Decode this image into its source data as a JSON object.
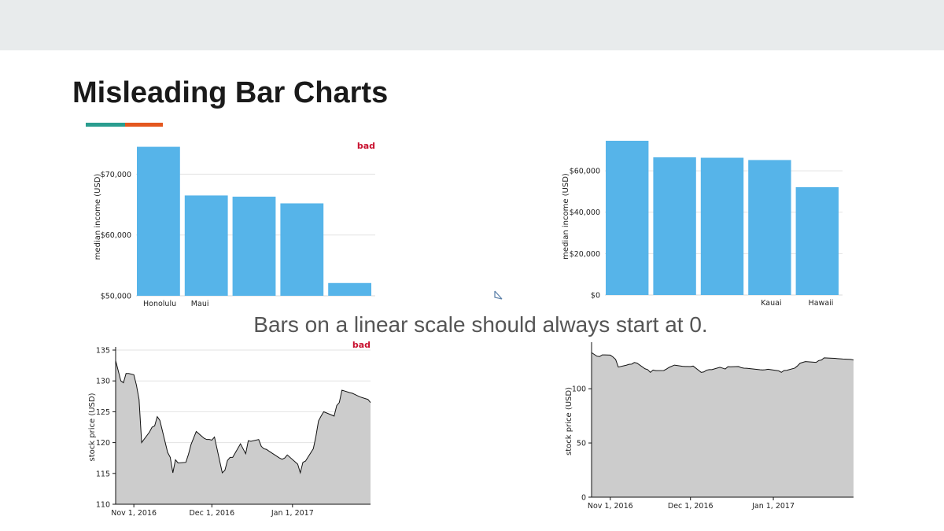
{
  "title": "Misleading Bar Charts",
  "caption": "Bars on a linear scale should always start at 0.",
  "colors": {
    "bar": "#56b4e9",
    "area": "#cccccc",
    "bad": "#c8102e",
    "accent_teal": "#2a9d8f",
    "accent_orange": "#e4571e",
    "topbar": "#e8ebec"
  },
  "chart_data": [
    {
      "type": "bar",
      "badge": "bad",
      "ylabel": "median income (USD)",
      "categories": [
        "Honolulu",
        "Maui",
        "",
        "",
        ""
      ],
      "values": [
        74500,
        66500,
        66300,
        65200,
        52100
      ],
      "ylim": [
        50000,
        76000
      ],
      "yticks": [
        50000,
        60000,
        70000
      ],
      "ytick_labels": [
        "$50,000",
        "$60,000",
        "$70,000"
      ]
    },
    {
      "type": "bar",
      "ylabel": "median income (USD)",
      "categories": [
        "",
        "",
        "",
        "Kauai",
        "Hawaii"
      ],
      "values": [
        74500,
        66500,
        66300,
        65200,
        52100
      ],
      "ylim": [
        0,
        76000
      ],
      "yticks": [
        0,
        20000,
        40000,
        60000
      ],
      "ytick_labels": [
        "$0",
        "$20,000",
        "$40,000",
        "$60,000"
      ]
    },
    {
      "type": "area",
      "badge": "bad",
      "ylabel": "stock price (USD)",
      "ylim": [
        110,
        135
      ],
      "yticks": [
        110,
        115,
        120,
        125,
        130,
        135
      ],
      "ytick_labels": [
        "110",
        "115",
        "120",
        "125",
        "130",
        "135"
      ],
      "xlim": [
        "2016-10-25",
        "2017-01-31"
      ],
      "xticks": [
        "2016-11-01",
        "2016-12-01",
        "2017-01-01"
      ],
      "xtick_labels": [
        "Nov 1, 2016",
        "Dec 1, 2016",
        "Jan 1, 2017"
      ],
      "x": [
        "2016-10-25",
        "2016-10-27",
        "2016-10-28",
        "2016-10-29",
        "2016-10-30",
        "2016-11-01",
        "2016-11-02",
        "2016-11-03",
        "2016-11-04",
        "2016-11-07",
        "2016-11-08",
        "2016-11-09",
        "2016-11-10",
        "2016-11-11",
        "2016-11-14",
        "2016-11-15",
        "2016-11-16",
        "2016-11-17",
        "2016-11-18",
        "2016-11-21",
        "2016-11-22",
        "2016-11-23",
        "2016-11-25",
        "2016-11-28",
        "2016-11-29",
        "2016-11-30",
        "2016-12-01",
        "2016-12-02",
        "2016-12-05",
        "2016-12-06",
        "2016-12-07",
        "2016-12-08",
        "2016-12-09",
        "2016-12-12",
        "2016-12-13",
        "2016-12-14",
        "2016-12-15",
        "2016-12-16",
        "2016-12-19",
        "2016-12-20",
        "2016-12-21",
        "2016-12-22",
        "2016-12-23",
        "2016-12-27",
        "2016-12-28",
        "2016-12-29",
        "2016-12-30",
        "2017-01-03",
        "2017-01-04",
        "2017-01-05",
        "2017-01-06",
        "2017-01-09",
        "2017-01-10",
        "2017-01-11",
        "2017-01-12",
        "2017-01-13",
        "2017-01-17",
        "2017-01-18",
        "2017-01-19",
        "2017-01-20",
        "2017-01-23",
        "2017-01-24",
        "2017-01-25",
        "2017-01-26",
        "2017-01-27",
        "2017-01-30",
        "2017-01-31"
      ],
      "y": [
        133.3,
        130.0,
        129.7,
        131.2,
        131.2,
        131.0,
        129.3,
        127.0,
        120.0,
        121.7,
        122.5,
        122.7,
        124.2,
        123.6,
        118.4,
        117.6,
        115.1,
        117.2,
        116.7,
        116.8,
        118.1,
        119.7,
        121.8,
        120.7,
        120.5,
        120.5,
        120.4,
        120.9,
        115.1,
        115.5,
        117.1,
        117.6,
        117.6,
        119.8,
        119.0,
        118.2,
        120.3,
        120.2,
        120.5,
        119.4,
        119.0,
        118.9,
        118.6,
        117.5,
        117.3,
        117.5,
        118.0,
        116.5,
        115.1,
        116.8,
        117.0,
        119.0,
        121.0,
        123.5,
        124.3,
        125.0,
        124.3,
        126.0,
        126.5,
        128.5,
        128.1,
        128.0,
        127.8,
        127.6,
        127.4,
        127.0,
        126.5
      ]
    },
    {
      "type": "area",
      "ylabel": "stock price (USD)",
      "ylim": [
        0,
        140
      ],
      "yticks": [
        0,
        50,
        100
      ],
      "ytick_labels": [
        "0",
        "50",
        "100"
      ],
      "xlim": [
        "2016-10-25",
        "2017-01-31"
      ],
      "xticks": [
        "2016-11-01",
        "2016-12-01",
        "2017-01-01"
      ],
      "xtick_labels": [
        "Nov 1, 2016",
        "Dec 1, 2016",
        "Jan 1, 2017"
      ],
      "same_series_as": 2
    }
  ]
}
